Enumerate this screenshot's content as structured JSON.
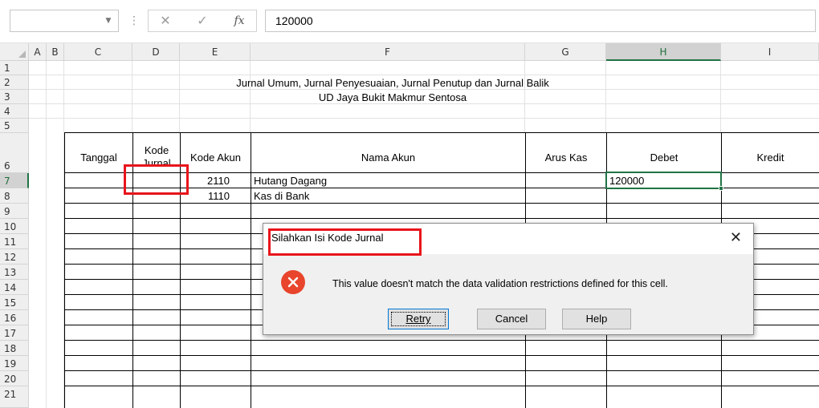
{
  "formula_bar": {
    "name_box": "",
    "cancel_icon": "close-icon",
    "enter_icon": "checkmark-icon",
    "fx_label": "fx",
    "formula_value": "120000"
  },
  "columns": [
    "A",
    "B",
    "C",
    "D",
    "E",
    "F",
    "G",
    "H",
    "I"
  ],
  "rows": [
    "1",
    "2",
    "3",
    "4",
    "5",
    "6",
    "7",
    "8",
    "9",
    "10",
    "11",
    "12",
    "13",
    "14",
    "15",
    "16",
    "17",
    "18",
    "19",
    "20",
    "21"
  ],
  "sheet": {
    "title_line1": "Jurnal Umum, Jurnal Penyesuaian, Jurnal Penutup dan Jurnal Balik",
    "title_line2": "UD Jaya Bukit Makmur Sentosa",
    "headers": {
      "tanggal": "Tanggal",
      "kode_jurnal": "Kode Jurnal",
      "kode_akun": "Kode Akun",
      "nama_akun": "Nama Akun",
      "arus_kas": "Arus Kas",
      "debet": "Debet",
      "kredit": "Kredit"
    },
    "entries": [
      {
        "kode_akun": "2110",
        "nama_akun": "Hutang Dagang",
        "debet": "120000"
      },
      {
        "kode_akun": "1110",
        "nama_akun": "Kas di Bank",
        "debet": ""
      }
    ],
    "active_cell": "H7"
  },
  "dialog": {
    "title": "Silahkan Isi Kode Jurnal",
    "message": "This value doesn't match the data validation restrictions defined for this cell.",
    "buttons": {
      "retry": "Retry",
      "cancel": "Cancel",
      "help": "Help"
    },
    "icon": "error-icon",
    "close_icon": "close-icon"
  },
  "colors": {
    "excel_green": "#217346",
    "highlight_red": "#e8141b",
    "error_red": "#e8452c"
  }
}
